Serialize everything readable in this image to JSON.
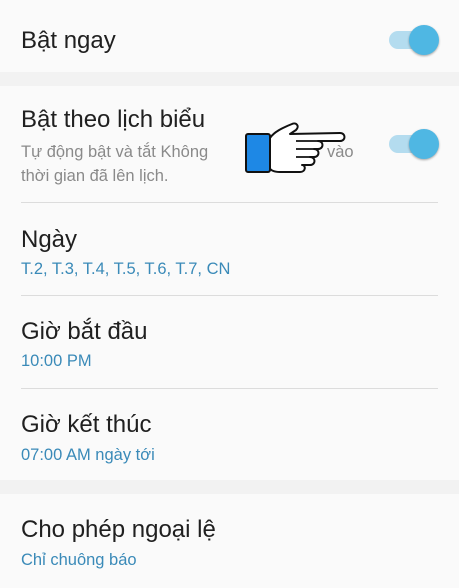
{
  "bat_ngay": {
    "title": "Bật ngay",
    "enabled": true
  },
  "schedule": {
    "title": "Bật theo lịch biểu",
    "description_line1": "Tự động bật và tắt Không",
    "description_line1_end": "vào",
    "description_line2": "thời gian đã lên lịch.",
    "enabled": true
  },
  "days": {
    "title": "Ngày",
    "value": "T.2, T.3, T.4, T.5, T.6, T.7, CN"
  },
  "start_time": {
    "title": "Giờ bắt đầu",
    "value": "10:00 PM"
  },
  "end_time": {
    "title": "Giờ kết thúc",
    "value": "07:00 AM ngày tới"
  },
  "exceptions": {
    "title": "Cho phép ngoại lệ",
    "value": "Chỉ chuông báo"
  },
  "colors": {
    "accent": "#4fb7e3",
    "accent_track": "#b4dcef",
    "value_text": "#3a8ab8",
    "background": "#f2f2f2",
    "card": "#fafafa",
    "pointer_cuff": "#1e88e5"
  },
  "icons": {
    "pointer": "pointing-hand-icon"
  }
}
